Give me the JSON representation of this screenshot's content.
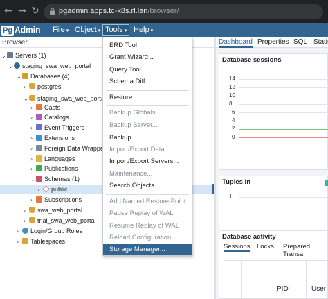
{
  "browser": {
    "back_glyph": "←",
    "forward_glyph": "→",
    "reload_glyph": "↻",
    "url_host": "pgadmin.apps.tc-k8s.rl.lan",
    "url_path": "/browser/"
  },
  "navbar": {
    "logo_pg": "Pg",
    "logo_admin": "Admin",
    "menus": [
      {
        "label": "File"
      },
      {
        "label": "Object"
      },
      {
        "label": "Tools"
      },
      {
        "label": "Help"
      }
    ],
    "caret": "▾",
    "brand_color": "#326690"
  },
  "browser_panel": {
    "title": "Browser",
    "tree": [
      {
        "label": "Servers (1)",
        "arrow": "⌄",
        "icon": "servers-icon"
      },
      {
        "label": "staging_swa_web_portal",
        "arrow": "⌄",
        "icon": "server-icon"
      },
      {
        "label": "Databases (4)",
        "arrow": "⌄",
        "icon": "databases-icon"
      },
      {
        "label": "postgres",
        "arrow": "›",
        "icon": "database-icon"
      },
      {
        "label": "staging_swa_web_portal",
        "arrow": "⌄",
        "icon": "database-icon"
      },
      {
        "label": "Casts",
        "arrow": "›",
        "icon": "casts-icon"
      },
      {
        "label": "Catalogs",
        "arrow": "›",
        "icon": "catalogs-icon"
      },
      {
        "label": "Event Triggers",
        "arrow": "›",
        "icon": "event-triggers-icon"
      },
      {
        "label": "Extensions",
        "arrow": "›",
        "icon": "extensions-icon"
      },
      {
        "label": "Foreign Data Wrappers",
        "arrow": "›",
        "icon": "fdw-icon"
      },
      {
        "label": "Languages",
        "arrow": "›",
        "icon": "languages-icon"
      },
      {
        "label": "Publications",
        "arrow": "›",
        "icon": "publications-icon"
      },
      {
        "label": "Schemas (1)",
        "arrow": "⌄",
        "icon": "schemas-icon"
      },
      {
        "label": "public",
        "arrow": "›",
        "icon": "schema-icon"
      },
      {
        "label": "Subscriptions",
        "arrow": "›",
        "icon": "subscriptions-icon"
      },
      {
        "label": "swa_web_portal",
        "arrow": "›",
        "icon": "database-icon"
      },
      {
        "label": "trial_swa_web_portal",
        "arrow": "›",
        "icon": "database-icon"
      },
      {
        "label": "Login/Group Roles",
        "arrow": "›",
        "icon": "roles-icon"
      },
      {
        "label": "Tablespaces",
        "arrow": "›",
        "icon": "tablespaces-icon"
      }
    ]
  },
  "tools_menu": {
    "items": [
      {
        "label": "ERD Tool",
        "disabled": false
      },
      {
        "label": "Grant Wizard...",
        "disabled": false
      },
      {
        "label": "Query Tool",
        "disabled": false
      },
      {
        "label": "Schema Diff",
        "disabled": false
      },
      {
        "label": "Restore...",
        "disabled": false
      },
      {
        "label": "Backup Globals...",
        "disabled": true
      },
      {
        "label": "Backup Server...",
        "disabled": true
      },
      {
        "label": "Backup...",
        "disabled": false
      },
      {
        "label": "Import/Export Data...",
        "disabled": true
      },
      {
        "label": "Import/Export Servers...",
        "disabled": false
      },
      {
        "label": "Maintenance...",
        "disabled": true
      },
      {
        "label": "Search Objects...",
        "disabled": false
      },
      {
        "label": "Add Named Restore Point...",
        "disabled": true
      },
      {
        "label": "Pause Replay of WAL",
        "disabled": true
      },
      {
        "label": "Resume Replay of WAL",
        "disabled": true
      },
      {
        "label": "Reload Configuration",
        "disabled": true
      },
      {
        "label": "Storage Manager...",
        "disabled": false,
        "highlighted": true
      }
    ]
  },
  "dashboard": {
    "tabs": [
      {
        "label": "Dashboard"
      },
      {
        "label": "Properties"
      },
      {
        "label": "SQL"
      },
      {
        "label": "Statis"
      }
    ],
    "sessions": {
      "title": "Database sessions",
      "ticks": [
        "14",
        "12",
        "10",
        "8",
        "6",
        "4",
        "2",
        "0"
      ]
    },
    "tuples": {
      "title": "Tuples in",
      "ticks": [
        "1"
      ]
    },
    "activity": {
      "title": "Database activity",
      "subtabs": [
        {
          "label": "Sessions"
        },
        {
          "label": "Locks"
        },
        {
          "label": "Prepared Transa"
        }
      ],
      "columns": [
        {
          "label": "PID"
        },
        {
          "label": "User"
        }
      ]
    }
  }
}
